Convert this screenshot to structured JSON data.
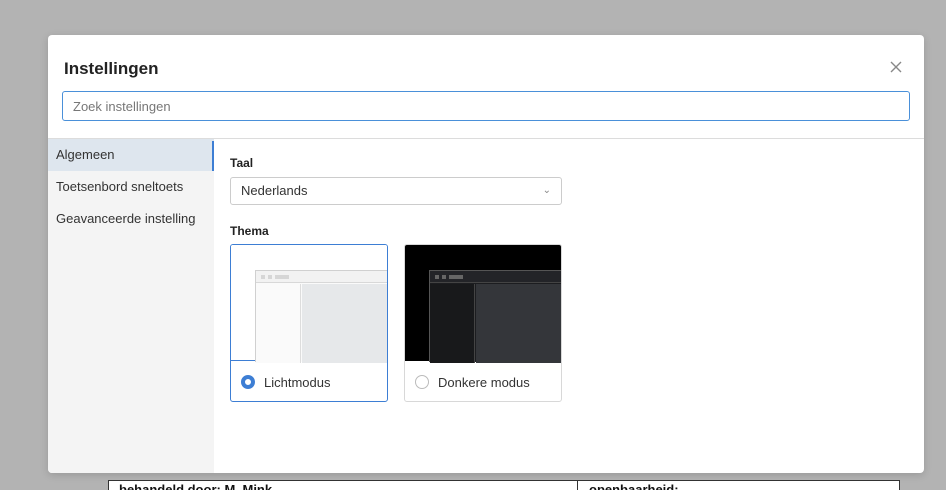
{
  "dialog": {
    "title": "Instellingen",
    "close_icon": "close-icon",
    "search_placeholder": "Zoek instellingen"
  },
  "sidebar": {
    "items": [
      {
        "label": "Algemeen",
        "active": true
      },
      {
        "label": "Toetsenbord sneltoets",
        "active": false
      },
      {
        "label": "Geavanceerde instelling",
        "active": false
      }
    ]
  },
  "general": {
    "language_label": "Taal",
    "language_value": "Nederlands",
    "theme_label": "Thema",
    "themes": [
      {
        "label": "Lichtmodus",
        "selected": true
      },
      {
        "label": "Donkere modus",
        "selected": false
      }
    ]
  },
  "background": {
    "cell1": "behandeld door: M. Mink",
    "cell2": "openbaarheid:"
  },
  "colors": {
    "accent": "#3d7ed4",
    "overlay": "#b3b3b3"
  }
}
